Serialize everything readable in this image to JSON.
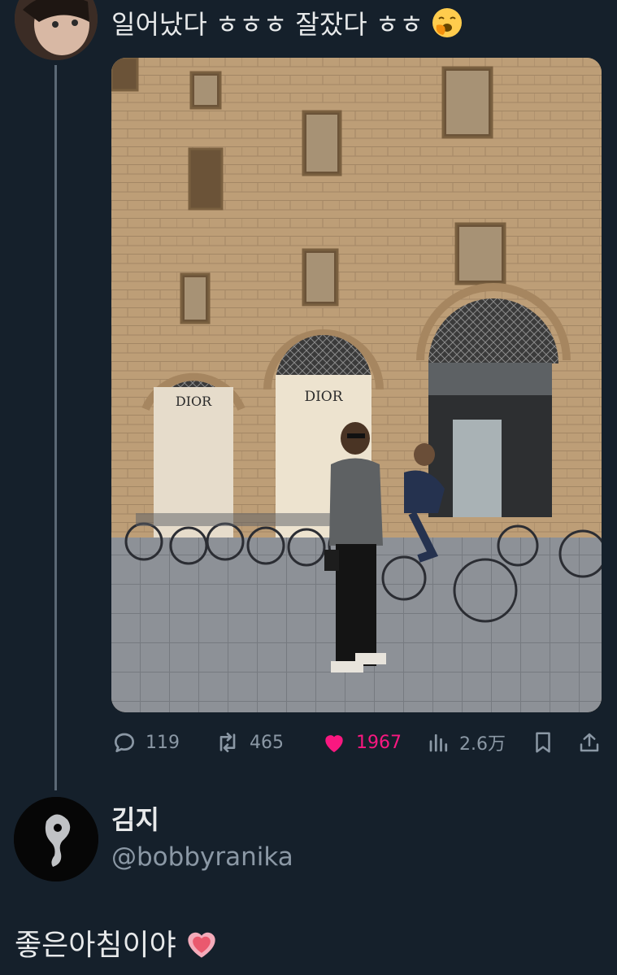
{
  "tweet": {
    "text": "일어났다 ㅎㅎㅎ 잘잤다 ㅎㅎ",
    "emoji": "yawning-face-emoji",
    "metrics": {
      "replies": "119",
      "retweets": "465",
      "likes": "1967",
      "views": "2.6万"
    },
    "icons": {
      "reply": "reply-icon",
      "retweet": "retweet-icon",
      "like": "heart-icon",
      "views": "views-icon",
      "bookmark": "bookmark-icon",
      "share": "share-icon"
    },
    "photo_signs": [
      "DIOR",
      "DIOR"
    ]
  },
  "reply": {
    "name": "김지",
    "handle": "@bobbyranika",
    "text": "좋은아침이야",
    "emoji": "growing-heart-emoji"
  },
  "colors": {
    "background": "#15202b",
    "text": "#e7e9ea",
    "muted": "#8b98a5",
    "like": "#f91880",
    "thread_line": "#5b6976"
  }
}
